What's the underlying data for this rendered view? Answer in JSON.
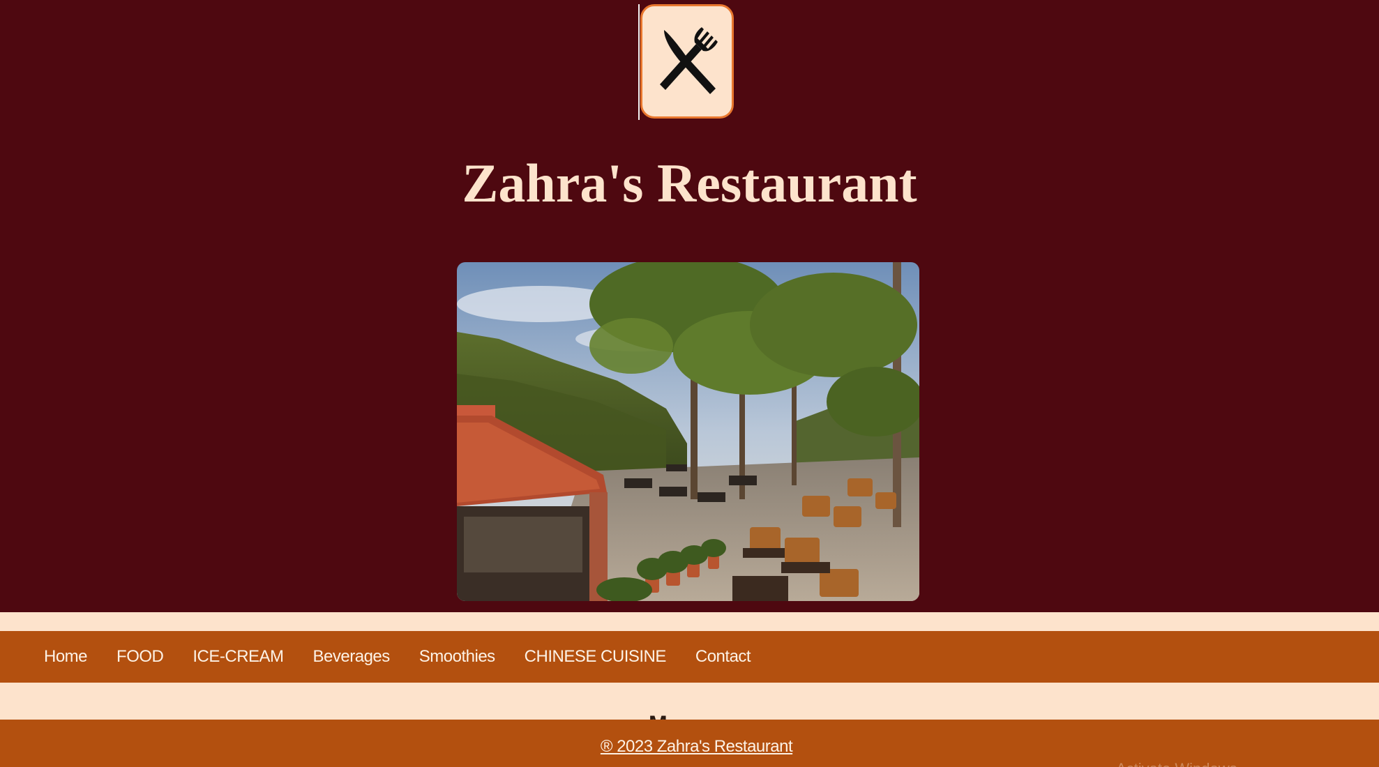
{
  "site": {
    "title": "Zahra's Restaurant",
    "logo_icon": "fork-knife-icon",
    "hero_image": "restaurant-terrace-photo"
  },
  "nav": {
    "items": [
      {
        "label": "Home"
      },
      {
        "label": "FOOD"
      },
      {
        "label": "ICE-CREAM"
      },
      {
        "label": "Beverages"
      },
      {
        "label": "Smoothies"
      },
      {
        "label": "CHINESE CUISINE"
      },
      {
        "label": "Contact"
      }
    ]
  },
  "section": {
    "heading_peek": "M"
  },
  "footer": {
    "copyright": "® 2023 Zahra's Restaurant"
  },
  "overlay": {
    "watermark": "Activate Windows"
  },
  "colors": {
    "background": "#4e0810",
    "accent": "#b3500f",
    "cream": "#fde3cc",
    "logo_border": "#e8772e"
  }
}
